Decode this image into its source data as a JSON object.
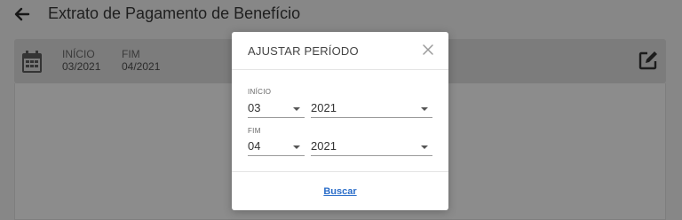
{
  "header": {
    "title": "Extrato de Pagamento de Benefício"
  },
  "period": {
    "start_label": "INÍCIO",
    "start_value": "03/2021",
    "end_label": "FIM",
    "end_value": "04/2021"
  },
  "modal": {
    "title": "AJUSTAR PERÍODO",
    "start_label": "INÍCIO",
    "start_month": "03",
    "start_year": "2021",
    "end_label": "FIM",
    "end_month": "04",
    "end_year": "2021",
    "search_label": "Buscar"
  }
}
